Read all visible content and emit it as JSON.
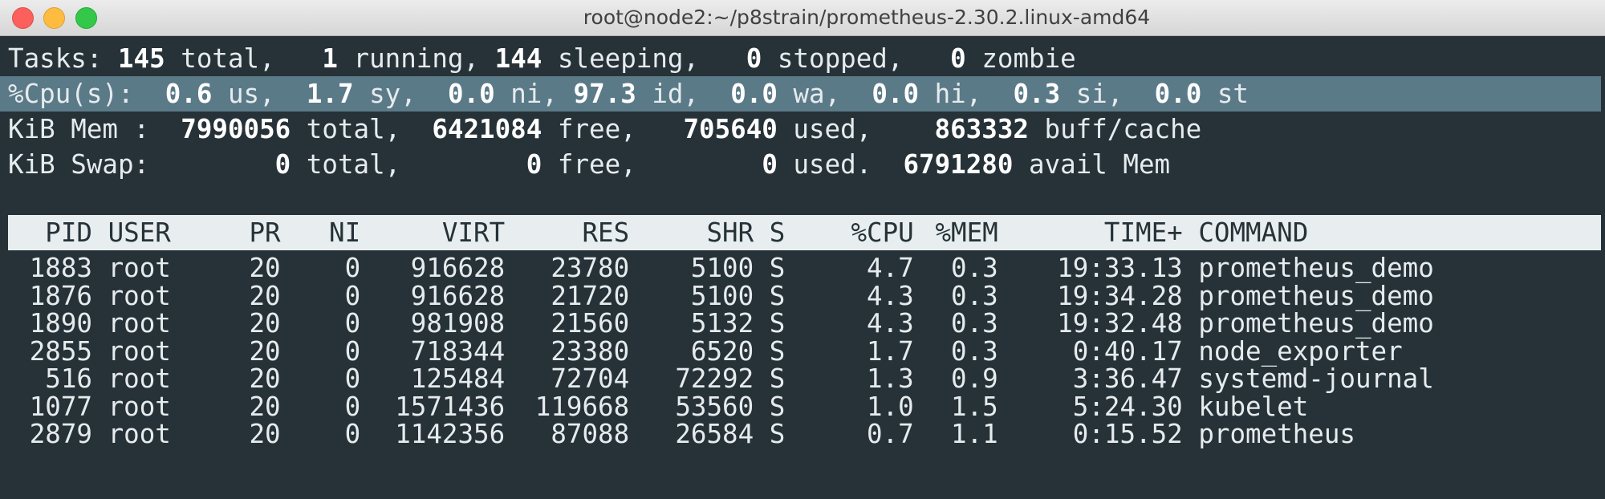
{
  "window": {
    "title": "root@node2:~/p8strain/prometheus-2.30.2.linux-amd64"
  },
  "summary": {
    "tasks": {
      "label": "Tasks:",
      "total": "145",
      "total_label": "total,",
      "running": "1",
      "running_label": "running,",
      "sleeping": "144",
      "sleeping_label": "sleeping,",
      "stopped": "0",
      "stopped_label": "stopped,",
      "zombie": "0",
      "zombie_label": "zombie"
    },
    "cpu": {
      "label": "%Cpu(s):",
      "us": "0.6",
      "us_label": "us,",
      "sy": "1.7",
      "sy_label": "sy,",
      "ni": "0.0",
      "ni_label": "ni,",
      "id": "97.3",
      "id_label": "id,",
      "wa": "0.0",
      "wa_label": "wa,",
      "hi": "0.0",
      "hi_label": "hi,",
      "si": "0.3",
      "si_label": "si,",
      "st": "0.0",
      "st_label": "st"
    },
    "mem": {
      "label": "KiB Mem :",
      "total": "7990056",
      "total_label": "total,",
      "free": "6421084",
      "free_label": "free,",
      "used": "705640",
      "used_label": "used,",
      "buff": "863332",
      "buff_label": "buff/cache"
    },
    "swap": {
      "label": "KiB Swap:",
      "total": "0",
      "total_label": "total,",
      "free": "0",
      "free_label": "free,",
      "used": "0",
      "used_label": "used.",
      "avail": "6791280",
      "avail_label": "avail Mem"
    }
  },
  "process_table": {
    "headers": {
      "pid": "PID",
      "user": "USER",
      "pr": "PR",
      "ni": "NI",
      "virt": "VIRT",
      "res": "RES",
      "shr": "SHR",
      "s": "S",
      "cpu": "%CPU",
      "mem": "%MEM",
      "time": "TIME+",
      "command": "COMMAND"
    },
    "rows": [
      {
        "pid": "1883",
        "user": "root",
        "pr": "20",
        "ni": "0",
        "virt": "916628",
        "res": "23780",
        "shr": "5100",
        "s": "S",
        "cpu": "4.7",
        "mem": "0.3",
        "time": "19:33.13",
        "command": "prometheus_demo"
      },
      {
        "pid": "1876",
        "user": "root",
        "pr": "20",
        "ni": "0",
        "virt": "916628",
        "res": "21720",
        "shr": "5100",
        "s": "S",
        "cpu": "4.3",
        "mem": "0.3",
        "time": "19:34.28",
        "command": "prometheus_demo"
      },
      {
        "pid": "1890",
        "user": "root",
        "pr": "20",
        "ni": "0",
        "virt": "981908",
        "res": "21560",
        "shr": "5132",
        "s": "S",
        "cpu": "4.3",
        "mem": "0.3",
        "time": "19:32.48",
        "command": "prometheus_demo"
      },
      {
        "pid": "2855",
        "user": "root",
        "pr": "20",
        "ni": "0",
        "virt": "718344",
        "res": "23380",
        "shr": "6520",
        "s": "S",
        "cpu": "1.7",
        "mem": "0.3",
        "time": "0:40.17",
        "command": "node_exporter"
      },
      {
        "pid": "516",
        "user": "root",
        "pr": "20",
        "ni": "0",
        "virt": "125484",
        "res": "72704",
        "shr": "72292",
        "s": "S",
        "cpu": "1.3",
        "mem": "0.9",
        "time": "3:36.47",
        "command": "systemd-journal"
      },
      {
        "pid": "1077",
        "user": "root",
        "pr": "20",
        "ni": "0",
        "virt": "1571436",
        "res": "119668",
        "shr": "53560",
        "s": "S",
        "cpu": "1.0",
        "mem": "1.5",
        "time": "5:24.30",
        "command": "kubelet"
      },
      {
        "pid": "2879",
        "user": "root",
        "pr": "20",
        "ni": "0",
        "virt": "1142356",
        "res": "87088",
        "shr": "26584",
        "s": "S",
        "cpu": "0.7",
        "mem": "1.1",
        "time": "0:15.52",
        "command": "prometheus"
      }
    ]
  },
  "colors": {
    "terminal_bg": "#263238",
    "text": "#e6ebee",
    "highlight_row": "#5b7a88",
    "header_bg": "#e8eef0"
  }
}
